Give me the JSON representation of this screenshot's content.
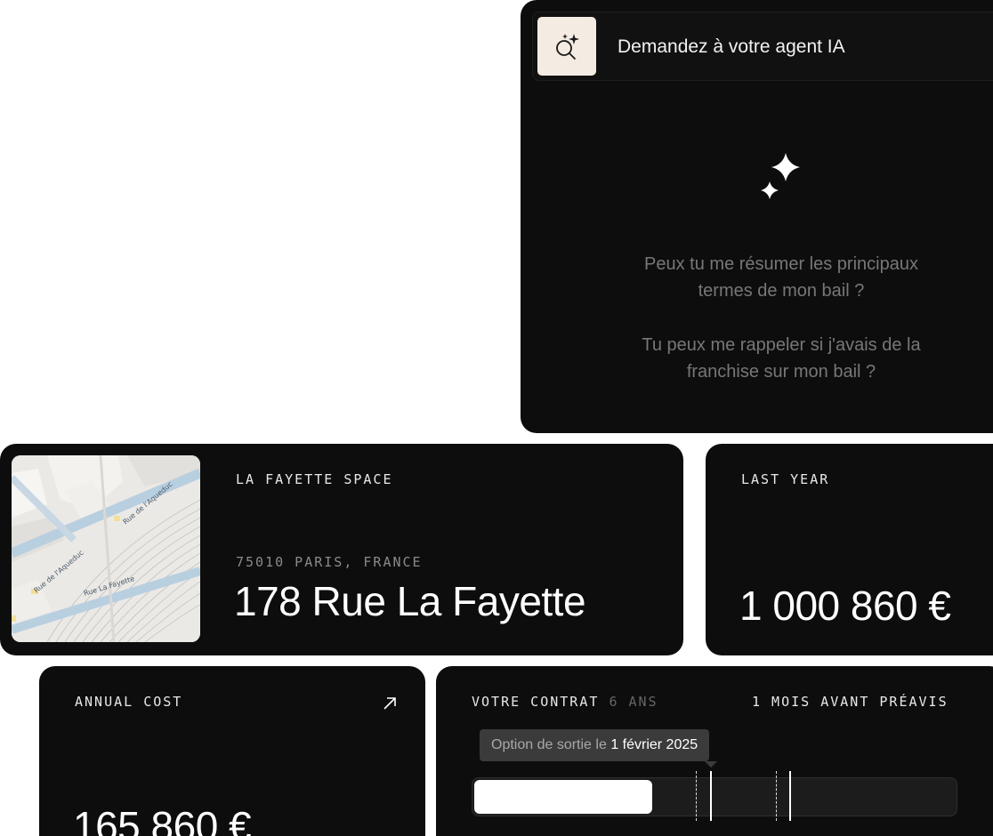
{
  "ai_agent": {
    "header_label": "Demandez à votre agent IA",
    "suggestions": [
      "Peux tu me résumer les principaux termes de mon bail ?",
      "Tu peux me rappeler si j'avais de la franchise sur mon bail ?"
    ],
    "icon": "sparkle-search-icon",
    "icon_bg_color": "#f4ece2"
  },
  "address": {
    "space_name": "LA FAYETTE SPACE",
    "city": "75010 PARIS, FRANCE",
    "street": "178 Rue La Fayette",
    "map_labels": [
      "Rue de l'Aqueduc",
      "Rue de l'Aqueduc",
      "Rue La Fayette"
    ]
  },
  "last_year": {
    "label": "LAST YEAR",
    "value": "1 000 860 €"
  },
  "annual_cost": {
    "label": "ANNUAL COST",
    "value": "165 860 €",
    "icon": "arrow-up-right-icon"
  },
  "contract": {
    "title": "VOTRE CONTRAT",
    "duration": "6 ANS",
    "notice": "1 MOIS AVANT PRÉAVIS",
    "tooltip_prefix": "Option de sortie le",
    "tooltip_date": "1 février 2025",
    "progress_fraction": 0.37
  },
  "colors": {
    "card_bg": "#0d0d0d",
    "accent_cream": "#f4ece2"
  }
}
